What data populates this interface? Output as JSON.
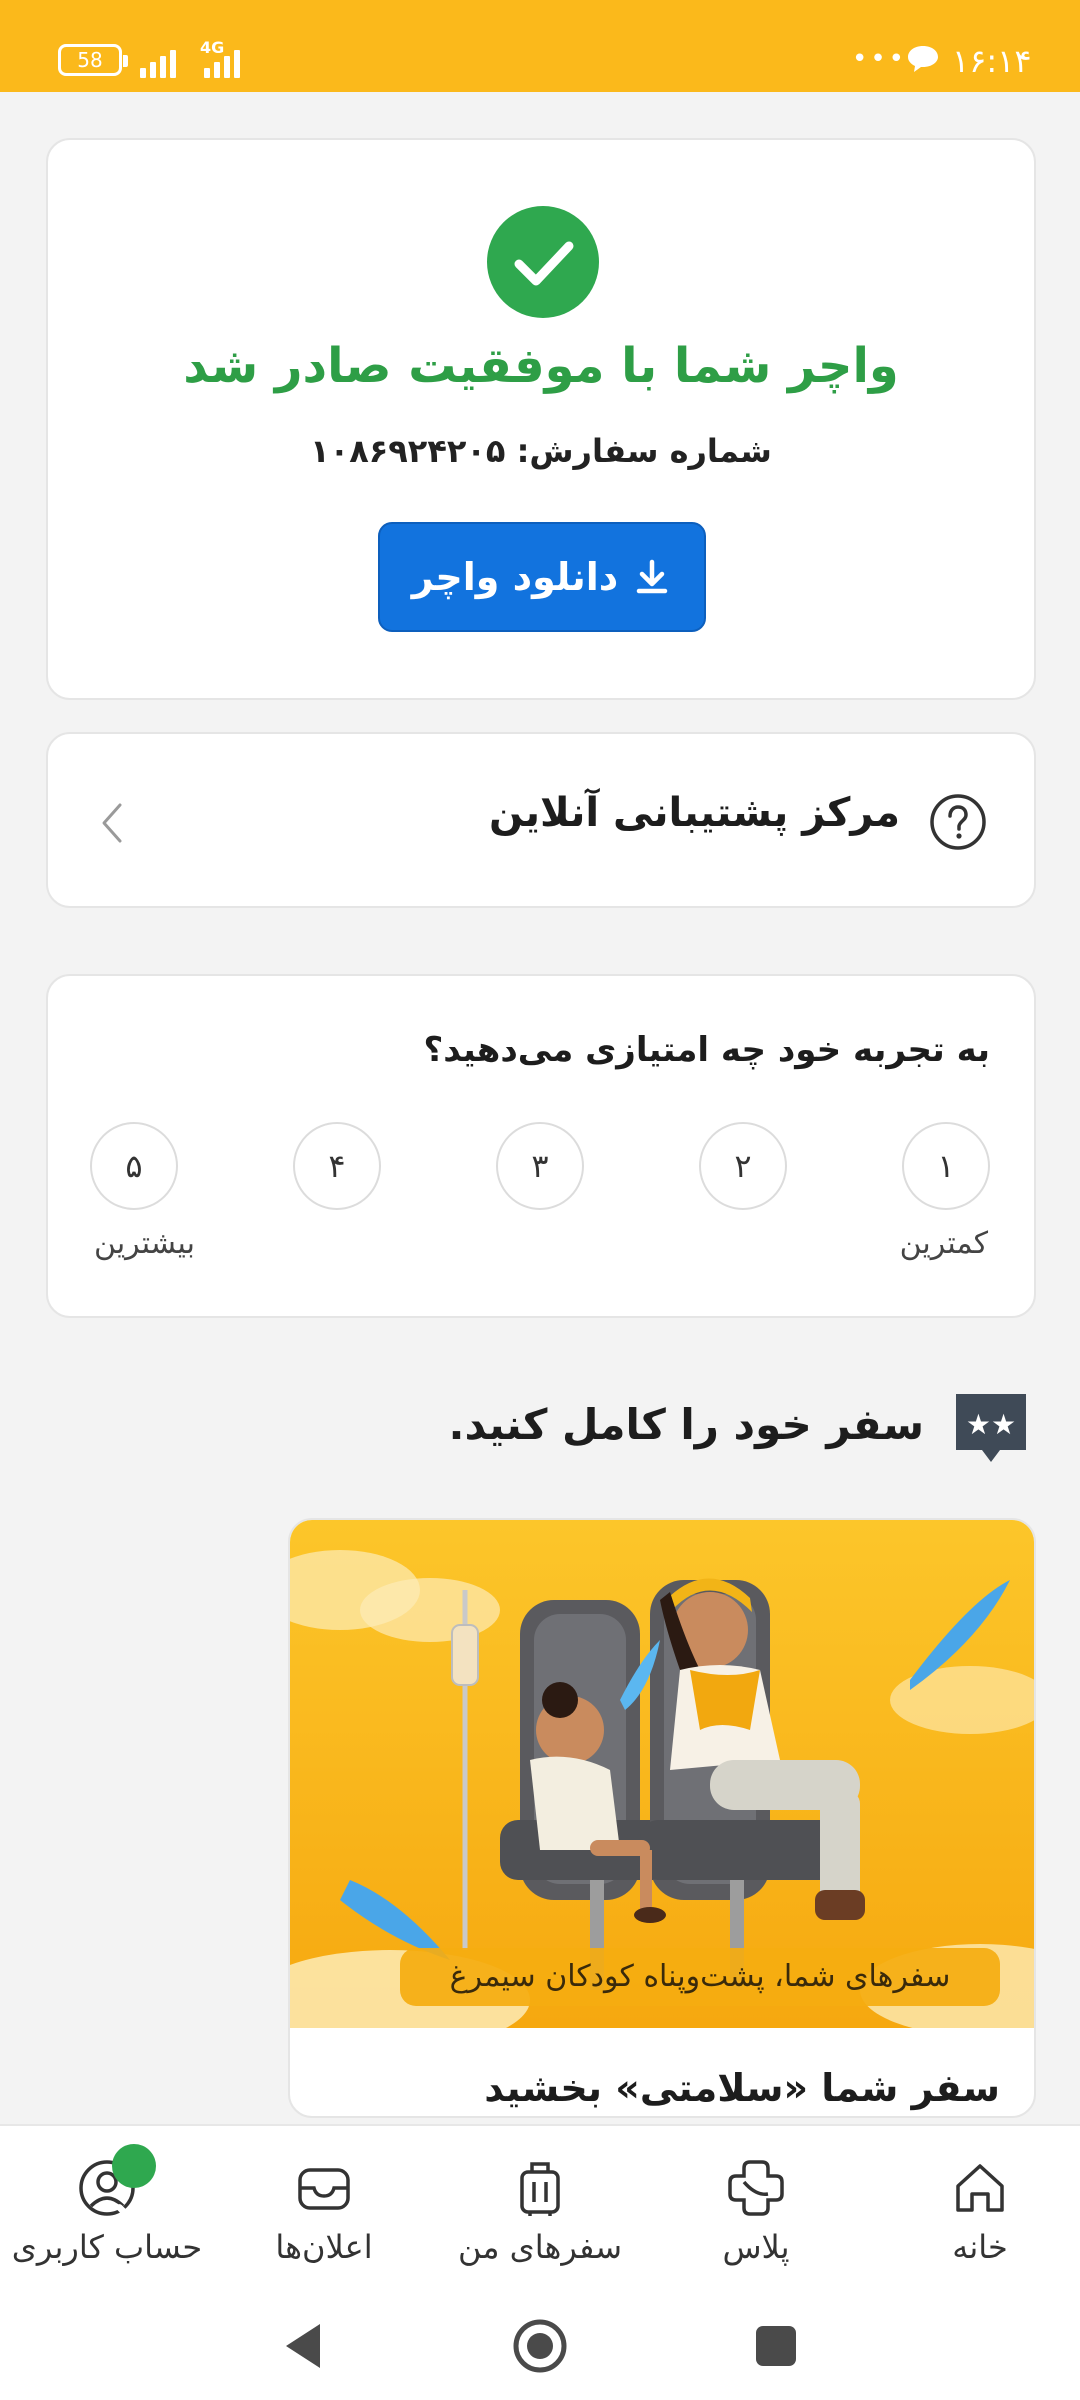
{
  "status_bar": {
    "time": "۱۶:۱۴",
    "battery": "58",
    "network": "4G",
    "more": "•••"
  },
  "success": {
    "title": "واچر شما با موفقیت صادر شد",
    "order_label": "شماره سفارش:",
    "order_number": "۱۰۸۶۹۲۴۲۰۵",
    "download_label": "دانلود واچر"
  },
  "support": {
    "title": "مرکز پشتیبانی آنلاین"
  },
  "rating": {
    "question": "به تجربه خود چه امتیازی می‌دهید؟",
    "options": [
      "۱",
      "۲",
      "۳",
      "۴",
      "۵"
    ],
    "low_label": "کمترین",
    "high_label": "بیشترین"
  },
  "complete_trip": {
    "title": "سفر خود را کامل کنید.",
    "promo_caption": "سفرهای شما، پشت‌وپناه کودکان سیمرغ",
    "promo_title": "سفر شما «سلامتی» بخشید"
  },
  "bottom_nav": {
    "home": "خانه",
    "plus": "پلاس",
    "my_trips": "سفرهای من",
    "notifications": "اعلان‌ها",
    "account": "حساب کاربری"
  },
  "colors": {
    "brand": "#fbb91b",
    "success": "#2fa84f",
    "primary": "#1273de"
  }
}
